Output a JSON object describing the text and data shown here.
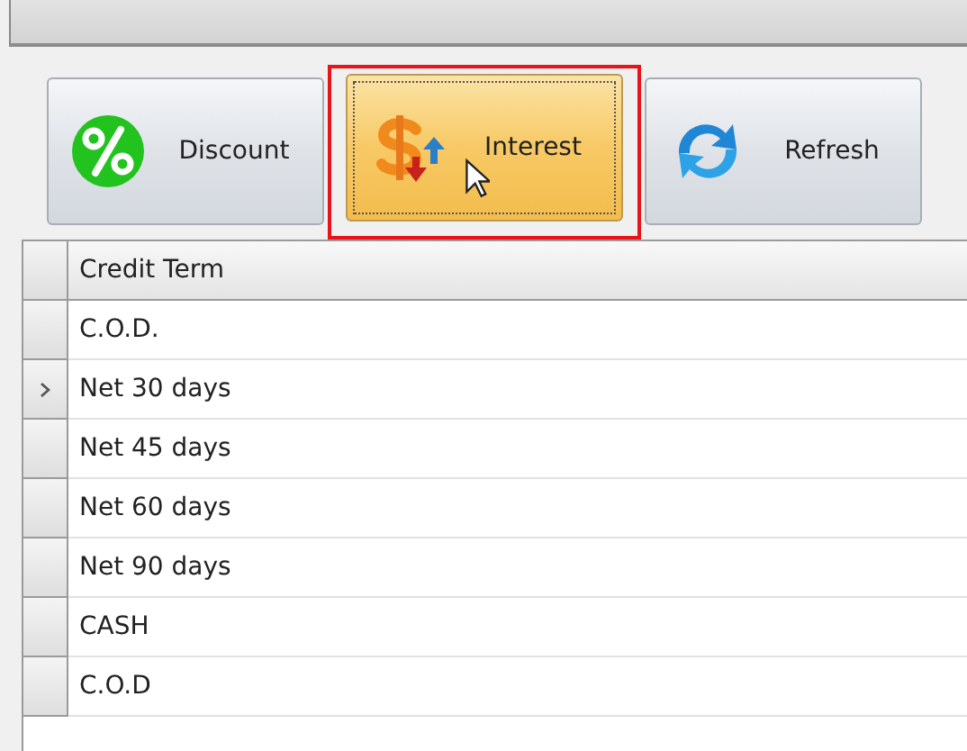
{
  "toolbar": {
    "buttons": [
      {
        "label": "Discount",
        "kind": "discount",
        "hot": false,
        "highlighted": false
      },
      {
        "label": "Interest",
        "kind": "interest",
        "hot": true,
        "highlighted": true
      },
      {
        "label": "Refresh",
        "kind": "refresh",
        "hot": false,
        "highlighted": false
      }
    ]
  },
  "grid": {
    "columns": [
      "Credit Term"
    ],
    "rows": [
      {
        "cells": [
          "C.O.D."
        ],
        "current": false
      },
      {
        "cells": [
          "Net 30 days"
        ],
        "current": true
      },
      {
        "cells": [
          "Net 45 days"
        ],
        "current": false
      },
      {
        "cells": [
          "Net 60 days"
        ],
        "current": false
      },
      {
        "cells": [
          "Net 90 days"
        ],
        "current": false
      },
      {
        "cells": [
          "CASH"
        ],
        "current": false
      },
      {
        "cells": [
          "C.O.D"
        ],
        "current": false
      }
    ]
  }
}
